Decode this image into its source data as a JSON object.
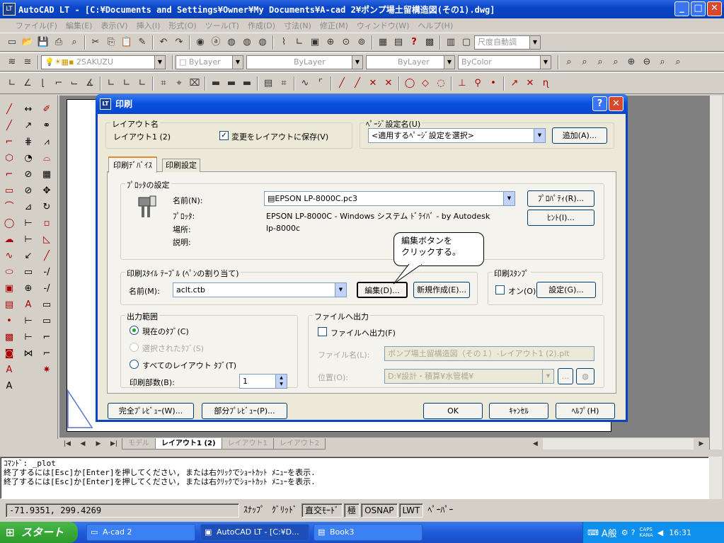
{
  "window": {
    "title": "AutoCAD LT - [C:¥Documents and Settings¥Owner¥My Documents¥A-cad 2¥ポンプ場土留構造図(その1).dwg]"
  },
  "menu": [
    "ファイル(F)",
    "編集(E)",
    "表示(V)",
    "挿入(I)",
    "形式(O)",
    "ツール(T)",
    "作成(D)",
    "寸法(N)",
    "修正(M)",
    "ウィンドウ(W)",
    "ヘルプ(H)"
  ],
  "toolbar": {
    "dimstyle": "尺度自動調",
    "layer": "2SAKUZU",
    "color": "ByLayer",
    "linetype": "ByLayer",
    "lineweight": "ByLayer",
    "plotstyle": "ByColor"
  },
  "layout_tabs": {
    "model": "モデル",
    "layout1": "レイアウト1 (2)",
    "layout_a": "レイアウト1",
    "layout_b": "レイアウト2"
  },
  "command_lines": [
    "ｺﾏﾝﾄﾞ: _plot",
    "終了するには[Esc]か[Enter]を押してください, または右ｸﾘｯｸでｼｮｰﾄｶｯﾄ ﾒﾆｭｰを表示.",
    "終了するには[Esc]か[Enter]を押してください, または右ｸﾘｯｸでｼｮｰﾄｶｯﾄ ﾒﾆｭｰを表示."
  ],
  "status": {
    "coords": "-71.9351, 299.4269",
    "snap": "ｽﾅｯﾌﾟ",
    "grid": "ｸﾞﾘｯﾄﾞ",
    "ortho": "直交ﾓｰﾄﾞ",
    "polar": "極",
    "osnap": "OSNAP",
    "lwt": "LWT",
    "paper": "ﾍﾟｰﾊﾟｰ"
  },
  "taskbar": {
    "start": "スタート",
    "tasks": [
      "A-cad 2",
      "AutoCAD LT - [C:¥D...",
      "Book3"
    ],
    "ime": "A般",
    "caps": "CAPS",
    "kana": "KANA",
    "time": "16:31"
  },
  "dialog": {
    "title": "印刷",
    "help_glyph": "?",
    "close_glyph": "✕",
    "layout_group": "レイアウト名",
    "layout_name": "レイアウト1 (2)",
    "save_changes_label": "変更をレイアウトに保存(V)",
    "save_changes_checked": true,
    "pagesetup_group": "ﾍﾟｰｼﾞ設定名(U)",
    "pagesetup_value": "<適用するﾍﾟｰｼﾞ設定を選択>",
    "add_button": "追加(A)...",
    "tabs": [
      "印刷ﾃﾞﾊﾞｲｽ",
      "印刷設定"
    ],
    "plotter_group": "ﾌﾟﾛｯﾀの設定",
    "name_label": "名前(N):",
    "plotter_name": "EPSON LP-8000C.pc3",
    "properties_button": "ﾌﾟﾛﾊﾟﾃｨ(R)...",
    "hints_button": "ﾋﾝﾄ(I)...",
    "plotter_label": "ﾌﾟﾛｯﾀ:",
    "plotter_value": "EPSON LP-8000C - Windows システム ﾄﾞﾗｲﾊﾞ - by Autodesk",
    "where_label": "場所:",
    "where_value": "lp-8000c",
    "desc_label": "説明:",
    "callout": "編集ボタンを\nクリックする。",
    "styletable_group": "印刷ｽﾀｲﾙ ﾃｰﾌﾞﾙ (ﾍﾟﾝの割り当て)",
    "style_name_label": "名前(M):",
    "style_name_value": "aclt.ctb",
    "edit_button": "編集(D)...",
    "new_button": "新規作成(E)...",
    "stamp_group": "印刷ｽﾀﾝﾌﾟ",
    "stamp_on_label": "オン(O)",
    "stamp_settings_button": "設定(G)...",
    "range_group": "出力範囲",
    "range_options": [
      "現在のﾀﾌﾞ(C)",
      "選択されたﾀﾌﾞ(S)",
      "すべてのレイアウト ﾀﾌﾞ(T)"
    ],
    "copies_label": "印刷部数(B):",
    "copies_value": "1",
    "file_group": "ファイルへ出力",
    "file_checkbox_label": "ファイルへ出力(F)",
    "filename_label": "ファイル名(L):",
    "filename_value": "ポンプ場土留構造図（その１）-レイアウト1 (2).plt",
    "location_label": "位置(O):",
    "location_value": "D:¥設計・積算¥水管橋¥",
    "browse_button": "...",
    "full_preview_button": "完全ﾌﾟﾚﾋﾞｭｰ(W)...",
    "partial_preview_button": "部分ﾌﾟﾚﾋﾞｭｰ(P)...",
    "ok_button": "OK",
    "cancel_button": "ｷｬﾝｾﾙ",
    "help_button": "ﾍﾙﾌﾟ(H)"
  }
}
